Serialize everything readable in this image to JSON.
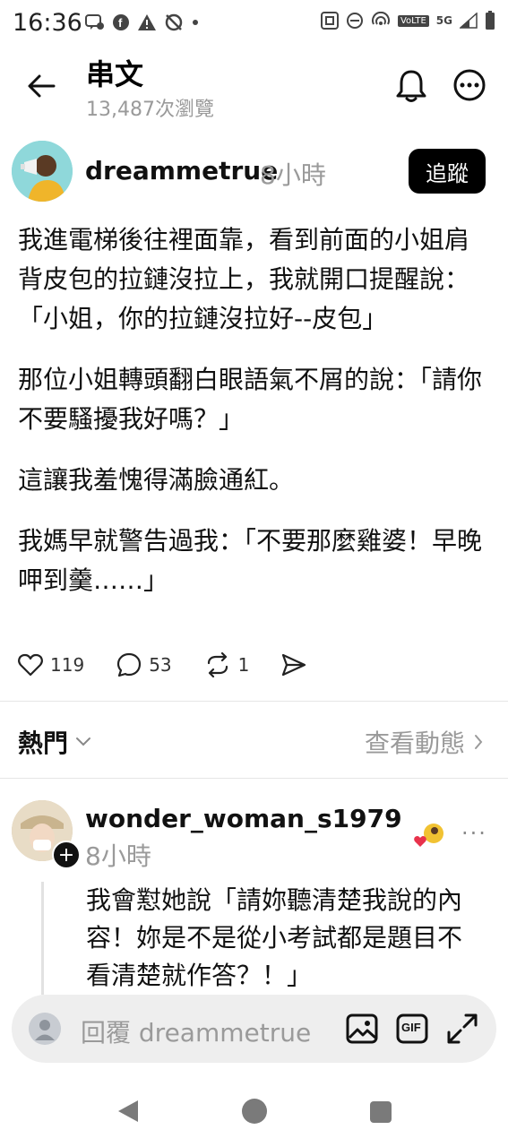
{
  "status_bar": {
    "time": "16:36",
    "network_label": "VoLTE",
    "signal_label": "5G"
  },
  "header": {
    "title": "串文",
    "views": "13,487次瀏覽"
  },
  "post": {
    "author": "dreammetrue",
    "time_ago": "8小時",
    "follow_label": "追蹤",
    "paragraphs": [
      "我進電梯後往裡面靠，看到前面的小姐肩背皮包的拉鏈沒拉上，我就開口提醒說：「小姐，你的拉鏈沒拉好--皮包」",
      "那位小姐轉頭翻白眼語氣不屑的說：「請你不要騷擾我好嗎？」",
      "這讓我羞愧得滿臉通紅。",
      "我媽早就警告過我：「不要那麼雞婆！早晚呷到羹……」"
    ],
    "likes": "119",
    "comments": "53",
    "reposts": "1"
  },
  "sort": {
    "label": "熱門",
    "activity_label": "查看動態"
  },
  "reply": {
    "author": "wonder_woman_s1979",
    "time_ago": "8小時",
    "text": "我會懟她說「請妳聽清楚我說的內容！妳是不是從小考試都是題目不看清楚就作答？！」"
  },
  "composer": {
    "placeholder": "回覆 dreammetrue",
    "gif_label": "GIF"
  },
  "colors": {
    "accent_follow": "#000000",
    "muted_text": "#9a9a9a",
    "composer_bg": "#eeeeee",
    "heart_red": "#e8324c"
  }
}
